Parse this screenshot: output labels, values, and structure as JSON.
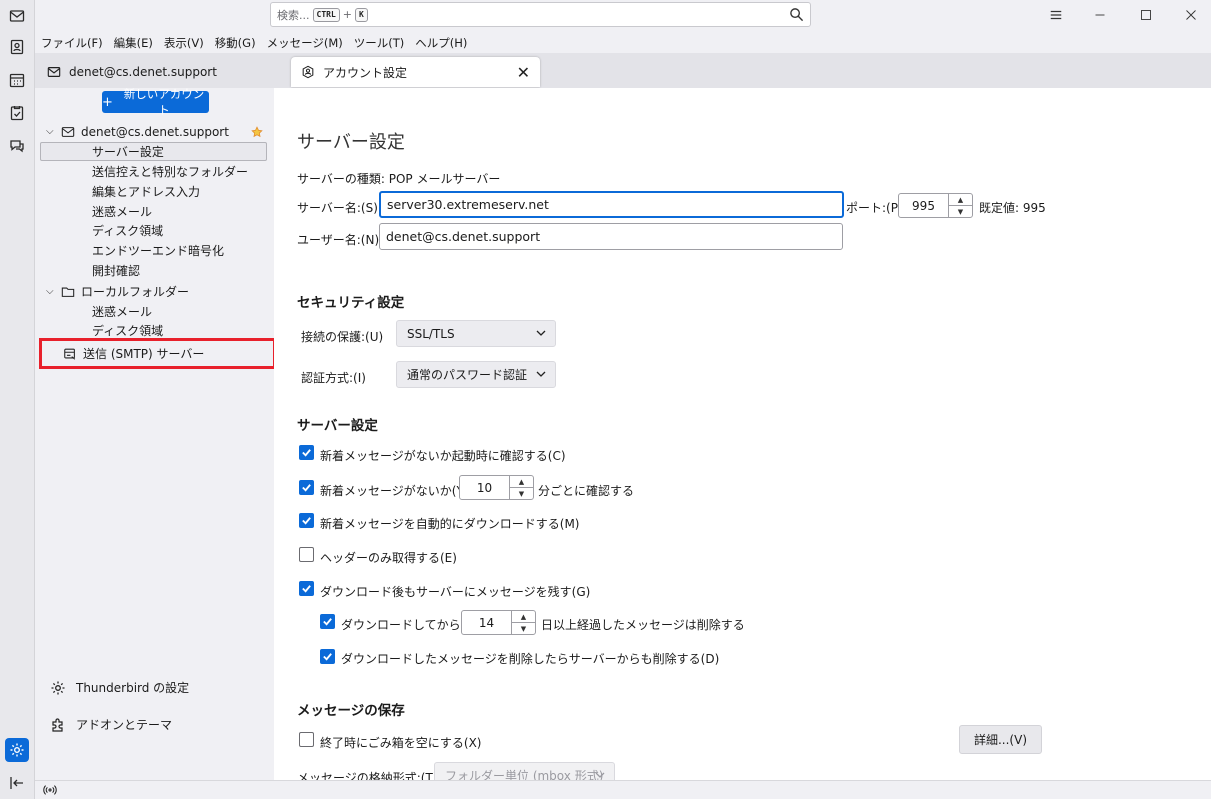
{
  "titlebar": {
    "search_placeholder": "検索...",
    "shortcut_key1": "CTRL",
    "shortcut_plus": "+",
    "shortcut_key2": "K"
  },
  "menu": [
    "ファイル(F)",
    "編集(E)",
    "表示(V)",
    "移動(G)",
    "メッセージ(M)",
    "ツール(T)",
    "ヘルプ(H)"
  ],
  "tabs": {
    "mail": "denet@cs.denet.support",
    "account": "アカウント設定"
  },
  "sidebar": {
    "new_account": "新しいアカウント",
    "account_name": "denet@cs.denet.support",
    "account_items": [
      "サーバー設定",
      "送信控えと特別なフォルダー",
      "編集とアドレス入力",
      "迷惑メール",
      "ディスク領域",
      "エンドツーエンド暗号化",
      "開封確認"
    ],
    "local_folders": "ローカルフォルダー",
    "local_items": [
      "迷惑メール",
      "ディスク領域"
    ],
    "smtp": "送信 (SMTP) サーバー",
    "thunderbird_settings": "Thunderbird の設定",
    "addons": "アドオンとテーマ"
  },
  "content": {
    "page_title": "サーバー設定",
    "server_type": "サーバーの種類: POP メールサーバー",
    "server_name_label": "サーバー名:(S)",
    "server_name_value": "server30.extremeserv.net",
    "port_label": "ポート:(P)",
    "port_value": "995",
    "default_port": "既定値: 995",
    "username_label": "ユーザー名:(N)",
    "username_value": "denet@cs.denet.support",
    "security_heading": "セキュリティ設定",
    "connection_label": "接続の保護:(U)",
    "connection_value": "SSL/TLS",
    "auth_label": "認証方式:(I)",
    "auth_value": "通常のパスワード認証",
    "server_settings_heading": "サーバー設定",
    "opt_check_startup": "新着メッセージがないか起動時に確認する(C)",
    "opt_check_every": "新着メッセージがないか(Y)",
    "check_interval": "10",
    "opt_check_every_suffix": "分ごとに確認する",
    "opt_auto_download": "新着メッセージを自動的にダウンロードする(M)",
    "opt_headers_only": "ヘッダーのみ取得する(E)",
    "opt_leave_on_server": "ダウンロード後もサーバーにメッセージを残す(G)",
    "opt_delete_after": "ダウンロードしてから(O)",
    "delete_days": "14",
    "opt_delete_after_suffix": "日以上経過したメッセージは削除する",
    "opt_delete_when_deleted": "ダウンロードしたメッセージを削除したらサーバーからも削除する(D)",
    "storage_heading": "メッセージの保存",
    "opt_empty_trash": "終了時にごみ箱を空にする(X)",
    "details_button": "詳細...(V)",
    "store_type_label": "メッセージの格納形式:(T)",
    "store_type_value": "フォルダー単位 (mbox 形式)"
  },
  "colors": {
    "accent": "#0b6ad8",
    "highlight_box": "#e8202b"
  },
  "icons": [
    "mail-icon",
    "address-book-icon",
    "calendar-icon",
    "tasks-icon",
    "chat-icon",
    "settings-icon",
    "collapse-icon",
    "search-icon",
    "minimize-icon",
    "maximize-icon",
    "close-icon",
    "account-settings-icon",
    "star-icon",
    "folder-icon",
    "outgoing-server-icon",
    "puzzle-icon",
    "wifi-icon"
  ]
}
